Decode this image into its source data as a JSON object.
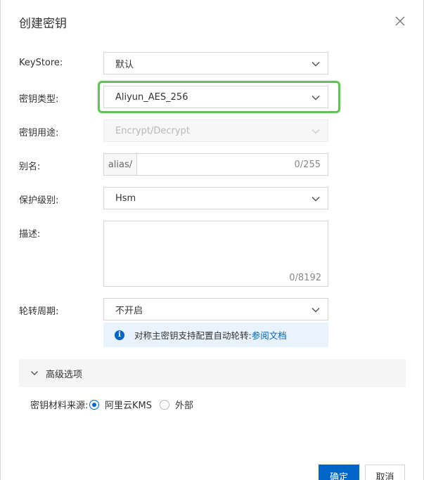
{
  "dialog": {
    "title": "创建密钥"
  },
  "form": {
    "keystore": {
      "label": "KeyStore:",
      "value": "默认"
    },
    "key_type": {
      "label": "密钥类型:",
      "value": "Aliyun_AES_256"
    },
    "key_usage": {
      "label": "密钥用途:",
      "value": "Encrypt/Decrypt"
    },
    "alias": {
      "label": "别名:",
      "prefix": "alias/",
      "counter": "0/255"
    },
    "protection_level": {
      "label": "保护级别:",
      "value": "Hsm"
    },
    "description": {
      "label": "描述:",
      "counter": "0/8192"
    },
    "rotation": {
      "label": "轮转周期:",
      "value": "不开启"
    },
    "notice": {
      "text": "对称主密钥支持配置自动轮转:",
      "link": "参阅文档"
    }
  },
  "advanced": {
    "title": "高级选项",
    "key_material_source": {
      "label": "密钥材料来源:",
      "options": [
        {
          "label": "阿里云KMS",
          "selected": true
        },
        {
          "label": "外部",
          "selected": false
        }
      ]
    }
  },
  "footer": {
    "confirm": "确定",
    "cancel": "取消"
  },
  "colors": {
    "primary": "#0064c8",
    "highlight": "#5fc451",
    "notice_bg": "#e9f3fd"
  }
}
